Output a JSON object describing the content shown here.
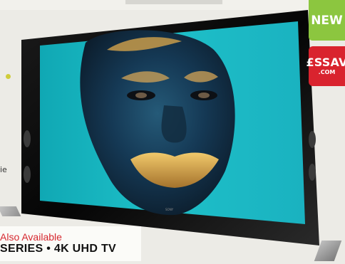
{
  "badges": {
    "new_label": "NEW",
    "brand_main": "£SSAV",
    "brand_sub": ".COM"
  },
  "caption": {
    "availability": "Also Available",
    "product": "SERIES • 4K UHD TV"
  },
  "left_text": "ie",
  "colors": {
    "new_badge": "#8cc63f",
    "brand_badge": "#d9232e",
    "caption_accent": "#d6282f"
  }
}
